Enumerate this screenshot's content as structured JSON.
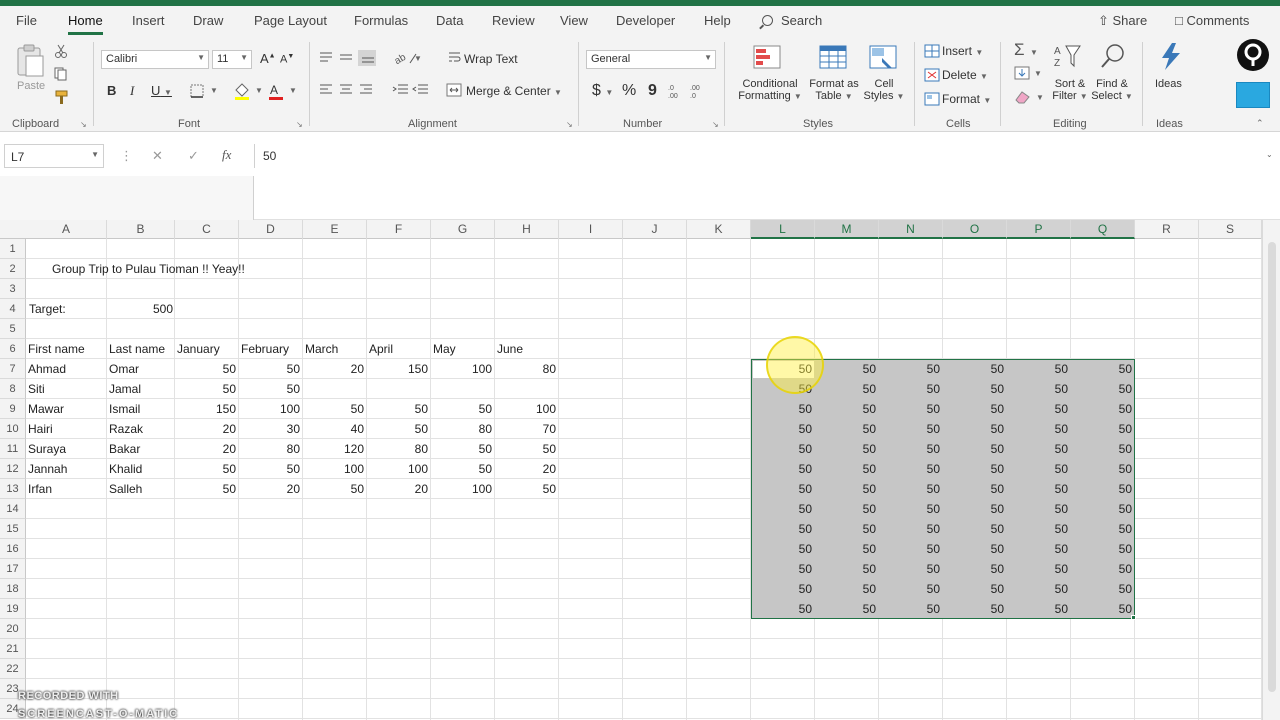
{
  "menu": {
    "tabs": [
      "File",
      "Home",
      "Insert",
      "Draw",
      "Page Layout",
      "Formulas",
      "Data",
      "Review",
      "View",
      "Developer",
      "Help"
    ],
    "active": "Home",
    "search_label": "Search",
    "share_label": "Share",
    "comments_label": "Comments"
  },
  "ribbon": {
    "clipboard": {
      "label": "Clipboard",
      "paste": "Paste"
    },
    "font": {
      "label": "Font",
      "name": "Calibri",
      "size": "11",
      "bold": "B",
      "italic": "I",
      "underline": "U",
      "grow": "A",
      "shrink": "A"
    },
    "alignment": {
      "label": "Alignment",
      "wrap_text": "Wrap Text",
      "merge_center": "Merge & Center"
    },
    "number": {
      "label": "Number",
      "format": "General",
      "currency": "$",
      "percent": "%",
      "comma": "9"
    },
    "styles": {
      "label": "Styles",
      "conditional": "Conditional",
      "formatting": "Formatting",
      "format_as": "Format as",
      "table": "Table",
      "cell": "Cell",
      "cell_styles": "Styles"
    },
    "cells": {
      "label": "Cells",
      "insert": "Insert",
      "delete": "Delete",
      "format": "Format"
    },
    "editing": {
      "label": "Editing",
      "sort": "Sort &",
      "filter": "Filter",
      "find": "Find &",
      "select": "Select"
    },
    "ideas": {
      "label": "Ideas",
      "ideas_btn": "Ideas"
    }
  },
  "formula_bar": {
    "name_box": "L7",
    "fx": "fx",
    "value": "50"
  },
  "columns": [
    "A",
    "B",
    "C",
    "D",
    "E",
    "F",
    "G",
    "H",
    "I",
    "J",
    "K",
    "L",
    "M",
    "N",
    "O",
    "P",
    "Q",
    "R",
    "S"
  ],
  "rows": [
    "1",
    "2",
    "3",
    "4",
    "5",
    "6",
    "7",
    "8",
    "9",
    "10",
    "11",
    "12",
    "13",
    "14",
    "15",
    "16",
    "17",
    "18",
    "19",
    "20",
    "21",
    "22",
    "23",
    "24"
  ],
  "sheet": {
    "title": "Group Trip to Pulau Tioman !! Yeay!!",
    "target_label": "Target:",
    "target_value": "500",
    "headers": [
      "First name",
      "Last name",
      "January",
      "February",
      "March",
      "April",
      "May",
      "June"
    ],
    "data": [
      [
        "Ahmad",
        "Omar",
        "50",
        "50",
        "20",
        "150",
        "100",
        "80"
      ],
      [
        "Siti",
        "Jamal",
        "50",
        "50",
        "",
        "",
        "",
        ""
      ],
      [
        "Mawar",
        "Ismail",
        "150",
        "100",
        "50",
        "50",
        "50",
        "100"
      ],
      [
        "Hairi",
        "Razak",
        "20",
        "30",
        "40",
        "50",
        "80",
        "70"
      ],
      [
        "Suraya",
        "Bakar",
        "20",
        "80",
        "120",
        "80",
        "50",
        "50"
      ],
      [
        "Jannah",
        "Khalid",
        "50",
        "50",
        "100",
        "100",
        "50",
        "20"
      ],
      [
        "Irfan",
        "Salleh",
        "50",
        "20",
        "50",
        "20",
        "100",
        "50"
      ]
    ],
    "fill_value": "50",
    "fill_rows": 13,
    "fill_cols": 6
  },
  "watermark": {
    "line1": "RECORDED WITH",
    "line2": "SCREENCAST-O-MATIC"
  }
}
